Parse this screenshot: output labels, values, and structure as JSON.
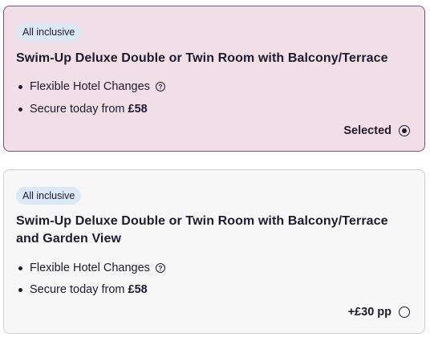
{
  "rooms": [
    {
      "badge": "All inclusive",
      "title": "Swim-Up Deluxe Double or Twin Room with Balcony/Terrace",
      "feature_1": "Flexible Hotel Changes",
      "feature_2_prefix": "Secure today from",
      "feature_2_price": "£58",
      "status": "Selected",
      "selected": true
    },
    {
      "badge": "All inclusive",
      "title": "Swim-Up Deluxe Double or Twin Room with Balcony/Terrace and Garden View",
      "feature_1": "Flexible Hotel Changes",
      "feature_2_prefix": "Secure today from",
      "feature_2_price": "£58",
      "status": "+£30 pp",
      "selected": false
    }
  ],
  "icons": {
    "help": "question-circle-icon",
    "radio_on": "radio-selected-icon",
    "radio_off": "radio-unselected-icon"
  }
}
